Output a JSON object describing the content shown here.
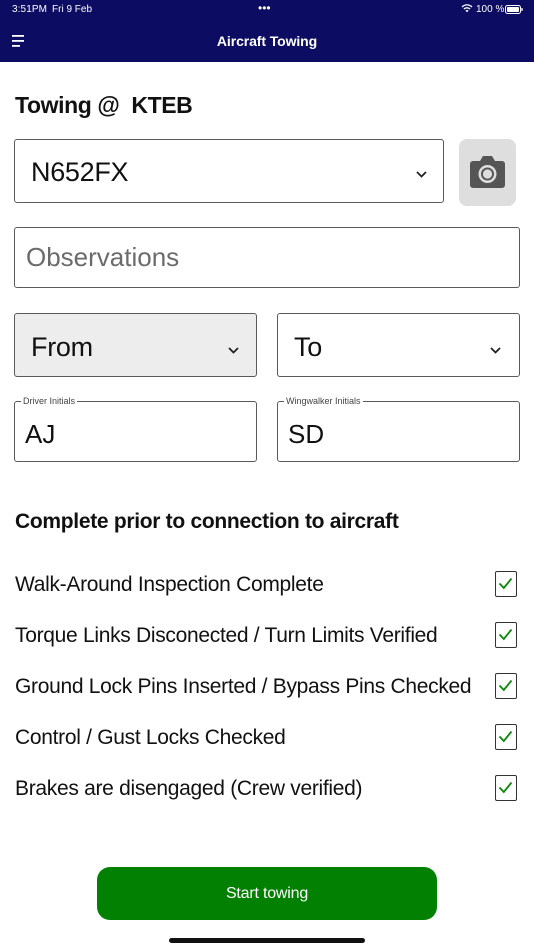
{
  "status_bar": {
    "time": "3:51PM",
    "date": "Fri 9 Feb",
    "dots": "•••",
    "battery": "100 %"
  },
  "header": {
    "title": "Aircraft Towing",
    "background": "#0b0c62"
  },
  "page": {
    "title": "Towing @  KTEB"
  },
  "aircraft": {
    "selected": "N652FX"
  },
  "observations": {
    "placeholder": "Observations",
    "value": ""
  },
  "from": {
    "selected": "From"
  },
  "to": {
    "selected": "To"
  },
  "driver": {
    "label": "Driver Initials",
    "value": "AJ"
  },
  "wingwalker": {
    "label": "Wingwalker Initials",
    "value": "SD"
  },
  "checklist": {
    "title": "Complete prior to connection to aircraft",
    "check_color": "#0a8a0a",
    "items": [
      {
        "label": "Walk-Around Inspection Complete",
        "checked": true
      },
      {
        "label": "Torque Links Disconected / Turn Limits Verified",
        "checked": true
      },
      {
        "label": "Ground Lock Pins Inserted / Bypass Pins Checked",
        "checked": true
      },
      {
        "label": "Control / Gust Locks Checked",
        "checked": true
      },
      {
        "label": "Brakes are disengaged (Crew verified)",
        "checked": true
      }
    ]
  },
  "actions": {
    "start_label": "Start towing",
    "start_color": "#018001"
  }
}
